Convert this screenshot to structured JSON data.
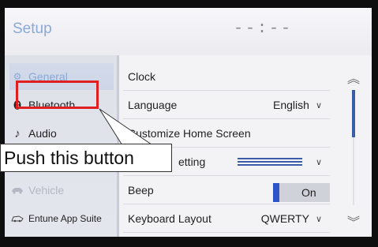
{
  "header": {
    "title": "Setup",
    "clock": "--:--"
  },
  "sidebar": {
    "items": [
      {
        "label": "General",
        "icon": "gear-icon"
      },
      {
        "label": "Bluetooth",
        "icon": "bluetooth-icon"
      },
      {
        "label": "Audio",
        "icon": "music-note-icon"
      },
      {
        "label": "Vehicle",
        "icon": "car-icon"
      },
      {
        "label": "Entune App Suite",
        "icon": "entune-icon"
      }
    ]
  },
  "settings": {
    "clock_label": "Clock",
    "language_label": "Language",
    "language_value": "English",
    "customize_label": "Customize Home Screen",
    "display_label": "etting",
    "beep_label": "Beep",
    "beep_value": "On",
    "keyboard_label": "Keyboard Layout",
    "keyboard_value": "QWERTY"
  },
  "annotation": {
    "callout_text": "Push this button"
  },
  "colors": {
    "accent": "#8aa9d6",
    "highlight": "#e02020",
    "toggle_on": "#2d55c9"
  }
}
